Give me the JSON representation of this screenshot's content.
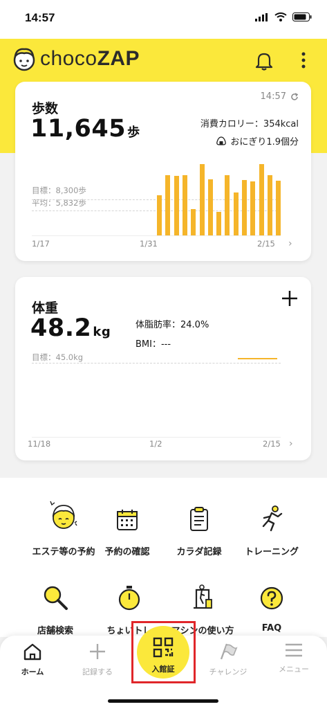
{
  "status_bar": {
    "time": "14:57"
  },
  "header": {
    "brand_light": "choco",
    "brand_bold": "ZAP"
  },
  "steps_card": {
    "title": "歩数",
    "value": "11,645",
    "unit": "歩",
    "updated_time": "14:57",
    "calories": "消費カロリー：354kcal",
    "onigiri": "おにぎり1.9個分",
    "goal": "目標：8,300歩",
    "average": "平均：5,832歩",
    "x_labels": [
      "1/17",
      "1/31",
      "2/15"
    ]
  },
  "weight_card": {
    "title": "体重",
    "value": "48.2",
    "unit": "kg",
    "body_fat": "体脂肪率：24.0%",
    "bmi": "BMI：---",
    "goal": "目標：45.0kg",
    "x_labels": [
      "11/18",
      "1/2",
      "2/15"
    ]
  },
  "chart_data": [
    {
      "type": "bar",
      "title": "歩数",
      "x_ticks": [
        "1/17",
        "1/31",
        "2/15"
      ],
      "reference_lines": [
        {
          "label": "目標：8,300歩",
          "value": 8300
        },
        {
          "label": "平均：5,832歩",
          "value": 5832
        }
      ],
      "categories": [
        "d1",
        "d2",
        "d3",
        "d4",
        "d5",
        "d6",
        "d7",
        "d8",
        "d9",
        "d10",
        "d11",
        "d12",
        "d13",
        "d14",
        "d15"
      ],
      "values": [
        7800,
        11600,
        11500,
        11600,
        5100,
        13800,
        10800,
        4600,
        11600,
        8300,
        10700,
        10400,
        13800,
        11600,
        10500
      ],
      "ylim": [
        0,
        16000
      ]
    },
    {
      "type": "line",
      "title": "体重",
      "x_ticks": [
        "11/18",
        "1/2",
        "2/15"
      ],
      "reference_lines": [
        {
          "label": "目標：45.0kg",
          "value": 45.0
        }
      ],
      "values": [
        48.2,
        48.2
      ],
      "ylim": [
        40,
        55
      ]
    }
  ],
  "menu": [
    {
      "label": "エステ等の予約",
      "icon": "face-care-icon"
    },
    {
      "label": "予約の確認",
      "icon": "calendar-icon"
    },
    {
      "label": "カラダ記録",
      "icon": "clipboard-icon"
    },
    {
      "label": "トレーニング",
      "icon": "runner-icon"
    },
    {
      "label": "店舗検索",
      "icon": "search-icon"
    },
    {
      "label": "ちょいトレ",
      "icon": "stopwatch-icon"
    },
    {
      "label": "マシンの使い方",
      "icon": "machine-icon"
    },
    {
      "label": "FAQ",
      "icon": "question-icon"
    }
  ],
  "tabs": {
    "home": "ホーム",
    "record": "記録する",
    "checkin": "入館証",
    "challenge": "チャレンジ",
    "menu": "メニュー"
  },
  "colors": {
    "brand_yellow": "#fbe83b",
    "bar_orange": "#f5b52a",
    "highlight_red": "#e0262a"
  }
}
